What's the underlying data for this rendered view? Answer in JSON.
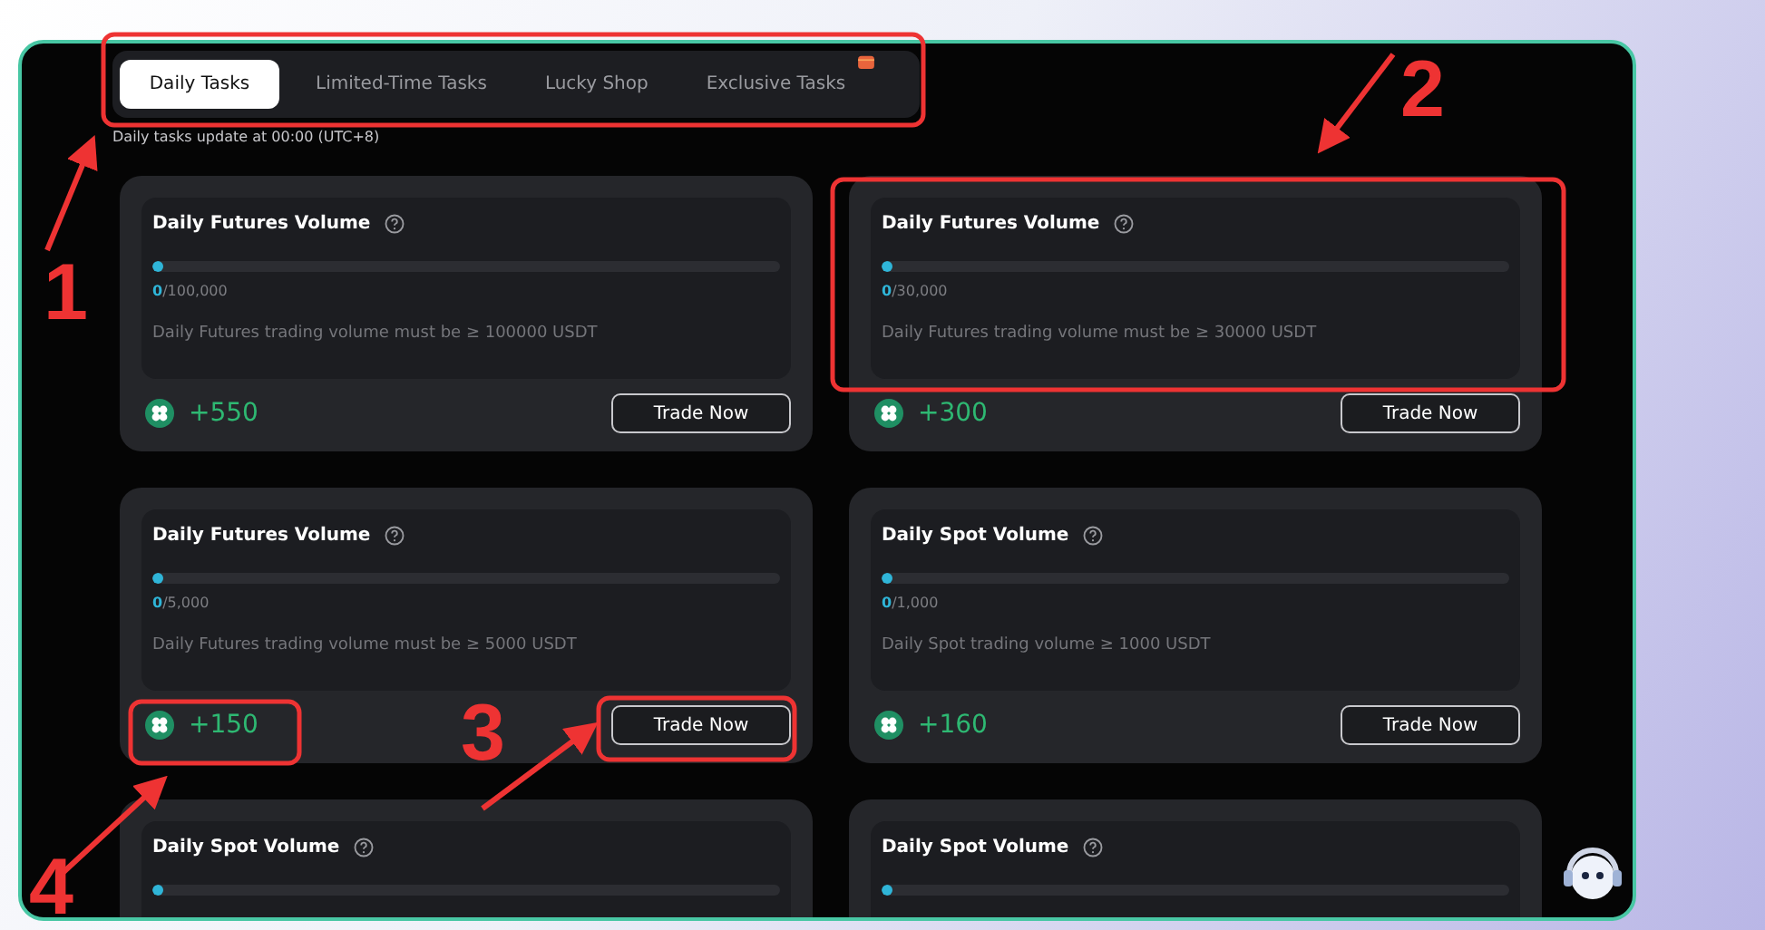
{
  "tabs": [
    {
      "label": "Daily Tasks",
      "selected": true,
      "badge": false
    },
    {
      "label": "Limited-Time Tasks",
      "selected": false,
      "badge": false
    },
    {
      "label": "Lucky Shop",
      "selected": false,
      "badge": false
    },
    {
      "label": "Exclusive Tasks",
      "selected": false,
      "badge": true
    }
  ],
  "update_note": "Daily tasks update at 00:00 (UTC+8)",
  "tasks": [
    {
      "title": "Daily Futures Volume",
      "level": 0,
      "progress_current": "0",
      "progress_target": "/100,000",
      "description": "Daily Futures trading volume must be ≥ 100000 USDT",
      "reward": "+550",
      "button": "Trade Now"
    },
    {
      "title": "Daily Futures Volume",
      "level": 0,
      "progress_current": "0",
      "progress_target": "/30,000",
      "description": "Daily Futures trading volume must be ≥ 30000 USDT",
      "reward": "+300",
      "button": "Trade Now"
    },
    {
      "title": "Daily Futures Volume",
      "level": 0,
      "progress_current": "0",
      "progress_target": "/5,000",
      "description": "Daily Futures trading volume must be ≥ 5000 USDT",
      "reward": "+150",
      "button": "Trade Now"
    },
    {
      "title": "Daily Spot Volume",
      "level": 0,
      "progress_current": "0",
      "progress_target": "/1,000",
      "description": "Daily Spot trading volume ≥ 1000 USDT",
      "reward": "+160",
      "button": "Trade Now"
    },
    {
      "title": "Daily Spot Volume",
      "level": 0
    },
    {
      "title": "Daily Spot Volume",
      "level": 0
    }
  ],
  "annotations": [
    {
      "label": "1"
    },
    {
      "label": "2"
    },
    {
      "label": "3"
    },
    {
      "label": "4"
    }
  ]
}
